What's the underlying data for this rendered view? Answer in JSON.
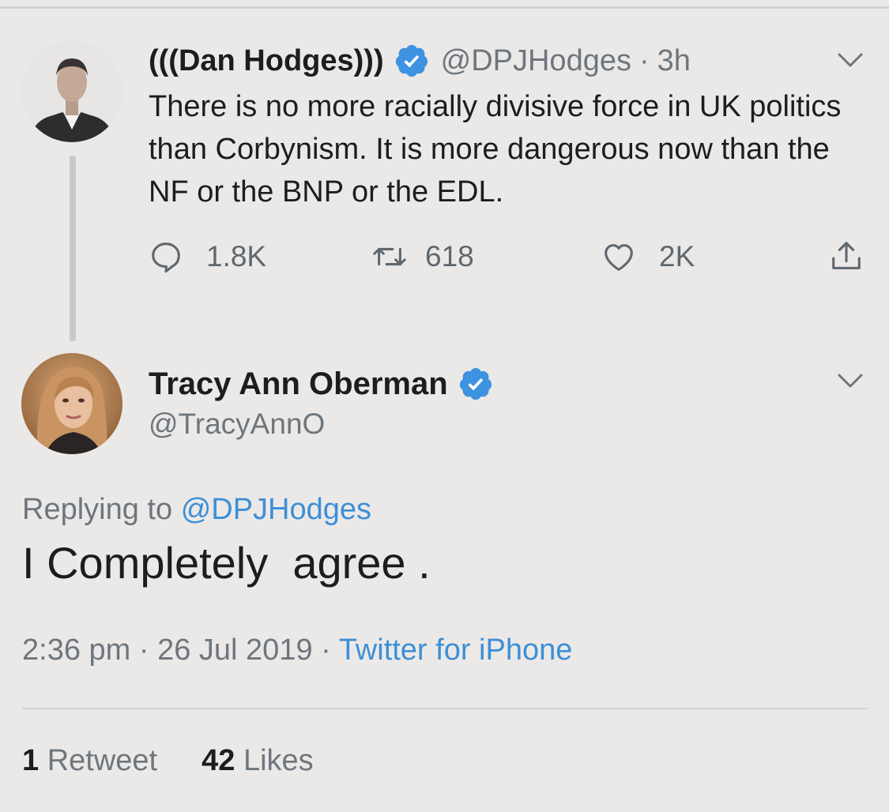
{
  "parent_tweet": {
    "name": "(((Dan Hodges)))",
    "handle": "@DPJHodges",
    "separator": "·",
    "time": "3h",
    "text": "There is no more racially divisive force in UK politics than Corbynism. It is more dangerous now than the NF or the BNP or the EDL.",
    "actions": {
      "replies": "1.8K",
      "retweets": "618",
      "likes": "2K"
    },
    "icons": [
      "verified-badge-icon",
      "chevron-down-icon",
      "reply-icon",
      "retweet-icon",
      "like-icon",
      "share-icon"
    ]
  },
  "main_tweet": {
    "name": "Tracy Ann Oberman",
    "handle": "@TracyAnnO",
    "replying_prefix": "Replying to",
    "replying_to": "@DPJHodges",
    "text": "I Completely  agree .",
    "time": "2:36 pm",
    "date": "26 Jul 2019",
    "separator": "·",
    "source": "Twitter for iPhone",
    "retweet_count": "1",
    "retweet_label": "Retweet",
    "likes_count": "42",
    "likes_label": "Likes"
  },
  "colors": {
    "background": "#ebe9e8",
    "link": "#3d8fd6",
    "verified": "#3d93e0",
    "muted": "#6e767d"
  }
}
